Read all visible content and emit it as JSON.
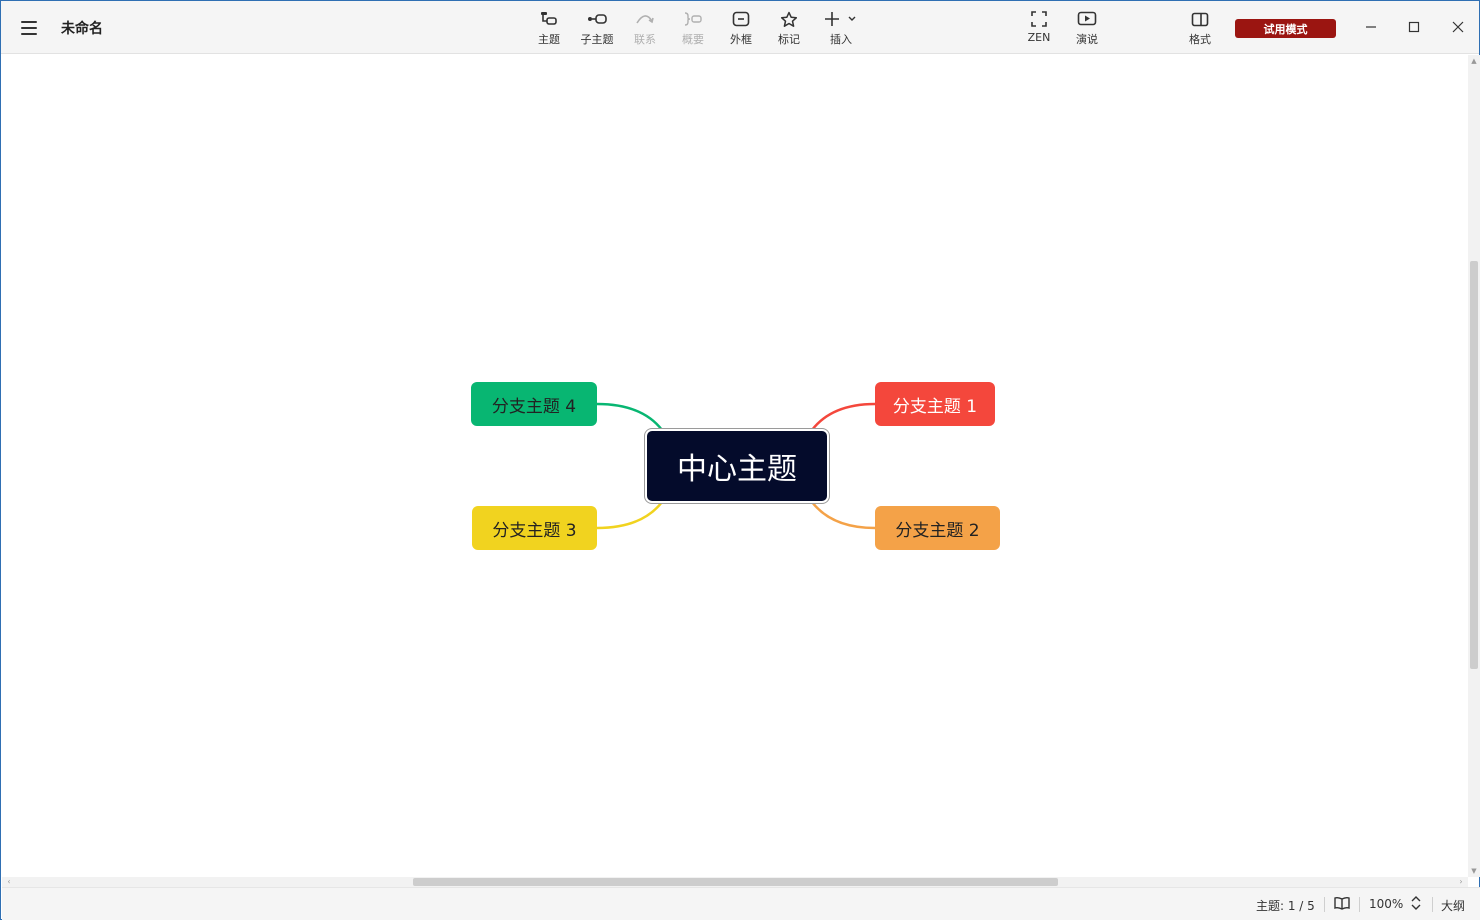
{
  "app": {
    "document_title": "未命名"
  },
  "toolbar": {
    "tools": [
      {
        "id": "topic",
        "label": "主题",
        "icon": "topic-icon",
        "enabled": true
      },
      {
        "id": "subtopic",
        "label": "子主题",
        "icon": "subtopic-icon",
        "enabled": true
      },
      {
        "id": "relationship",
        "label": "联系",
        "icon": "relationship-icon",
        "enabled": false
      },
      {
        "id": "summary",
        "label": "概要",
        "icon": "summary-icon",
        "enabled": false
      },
      {
        "id": "boundary",
        "label": "外框",
        "icon": "boundary-icon",
        "enabled": true
      },
      {
        "id": "marker",
        "label": "标记",
        "icon": "star-icon",
        "enabled": true
      },
      {
        "id": "insert",
        "label": "插入",
        "icon": "plus-icon",
        "enabled": true
      },
      {
        "id": "zen",
        "label": "ZEN",
        "icon": "fullscreen-icon",
        "enabled": true
      },
      {
        "id": "pitch",
        "label": "演说",
        "icon": "play-icon",
        "enabled": true
      },
      {
        "id": "format",
        "label": "格式",
        "icon": "format-panel-icon",
        "enabled": true
      }
    ],
    "trial_label": "试用模式"
  },
  "mindmap": {
    "central": "中心主题",
    "branches": [
      {
        "label": "分支主题 1",
        "color": "#f4473c"
      },
      {
        "label": "分支主题 2",
        "color": "#f4a248"
      },
      {
        "label": "分支主题 3",
        "color": "#f1d31f"
      },
      {
        "label": "分支主题 4",
        "color": "#08b672"
      }
    ]
  },
  "status": {
    "topic_count": "主题: 1 / 5",
    "zoom": "100%",
    "outline": "大纲"
  },
  "colors": {
    "central_bg": "#040b2b",
    "trial_bg": "#9b1511"
  }
}
